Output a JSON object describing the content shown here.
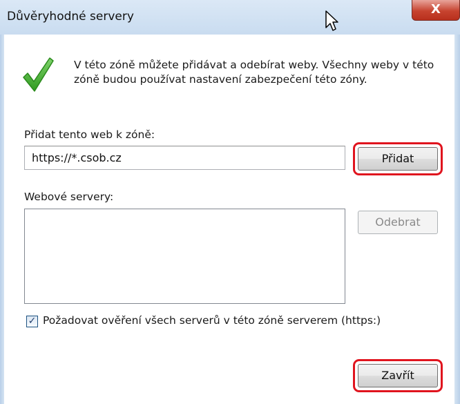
{
  "window": {
    "title": "Důvěryhodné servery",
    "close_label": "X"
  },
  "icons": {
    "check": "check-icon",
    "cursor": "mouse-cursor-icon"
  },
  "colors": {
    "check_green": "#3fae2a",
    "highlight_red": "#e0141e",
    "titlebar": "#c9dcf0"
  },
  "info": {
    "text": "V této zóně můžete přidávat a odebírat weby. Všechny weby v této zóně budou používat nastavení zabezpečení této zóny."
  },
  "add_site": {
    "label": "Přidat tento web k zóně:",
    "value": "https://*.csob.cz",
    "add_button": "Přidat"
  },
  "websites": {
    "label": "Webové servery:",
    "items": [],
    "remove_button": "Odebrat"
  },
  "verify": {
    "label": "Požadovat ověření všech serverů v této zóně serverem (https:)",
    "checked": true
  },
  "footer": {
    "close_button": "Zavřít"
  }
}
